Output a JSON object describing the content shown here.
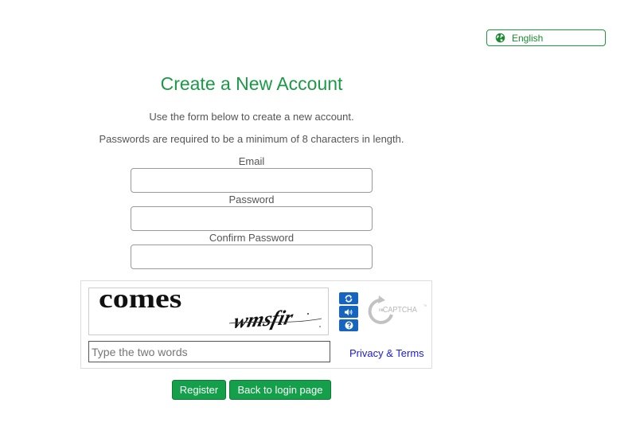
{
  "language": {
    "label": "English",
    "icon": "globe-icon"
  },
  "form": {
    "title": "Create a New Account",
    "intro": "Use the form below to create a new account.",
    "password_note": "Passwords are required to be a minimum of 8 characters in length.",
    "email_label": "Email",
    "email_value": "",
    "password_label": "Password",
    "password_value": "",
    "confirm_label": "Confirm Password",
    "confirm_value": ""
  },
  "captcha": {
    "word1": "comes",
    "word2": "wmsfir",
    "placeholder": "Type the two words",
    "privacy_link": "Privacy & Terms",
    "logo_text": "reCAPTCHA",
    "controls": [
      "refresh-icon",
      "audio-icon",
      "help-icon"
    ],
    "accent_color": "#1565c0"
  },
  "buttons": {
    "register": "Register",
    "back": "Back to login page"
  },
  "colors": {
    "title": "#1b9a46",
    "button": "#14a04a",
    "link": "#1a1adb"
  }
}
